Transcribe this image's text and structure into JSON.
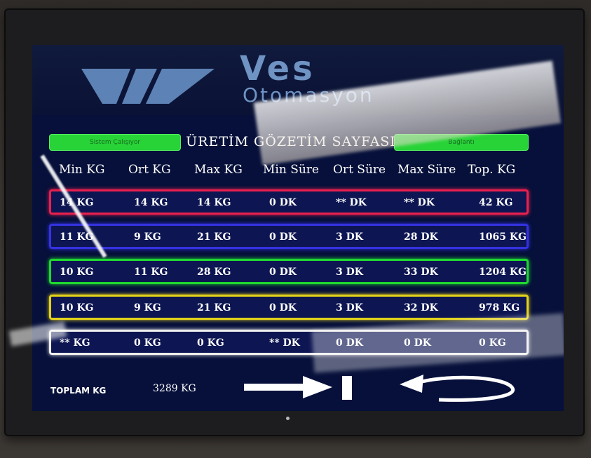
{
  "logo": {
    "name": "Ves",
    "tagline": "Otomasyon"
  },
  "panel": {
    "title": "ÜRETİM GÖZETİM SAYFASI",
    "left_status": "Sistem Çalışıyor",
    "right_status": "Bağlantı"
  },
  "table": {
    "headers": [
      "Min KG",
      "Ort KG",
      "Max KG",
      "Min Süre",
      "Ort Süre",
      "Max Süre",
      "Top. KG"
    ],
    "rows": [
      {
        "color": "#e8204e",
        "cells": [
          "14 KG",
          "14 KG",
          "14 KG",
          "0 DK",
          "** DK",
          "** DK",
          "42 KG"
        ]
      },
      {
        "color": "#3432e0",
        "cells": [
          "11 KG",
          "9 KG",
          "21 KG",
          "0 DK",
          "3 DK",
          "28 DK",
          "1065 KG"
        ]
      },
      {
        "color": "#1fd72f",
        "cells": [
          "10 KG",
          "11 KG",
          "28 KG",
          "0 DK",
          "3 DK",
          "33 DK",
          "1204 KG"
        ]
      },
      {
        "color": "#e3d21a",
        "cells": [
          "10 KG",
          "9 KG",
          "21 KG",
          "0 DK",
          "3 DK",
          "32 DK",
          "978 KG"
        ]
      },
      {
        "color": "#eeeeee",
        "cells": [
          "** KG",
          "0 KG",
          "0 KG",
          "** DK",
          "0 DK",
          "0 DK",
          "0 KG"
        ]
      }
    ]
  },
  "footer": {
    "total_label": "TOPLAM KG",
    "total_value": "3289 KG"
  },
  "icons": {
    "next": "arrow-right-icon",
    "pause": "bar-icon",
    "back": "undo-arrow-icon"
  }
}
